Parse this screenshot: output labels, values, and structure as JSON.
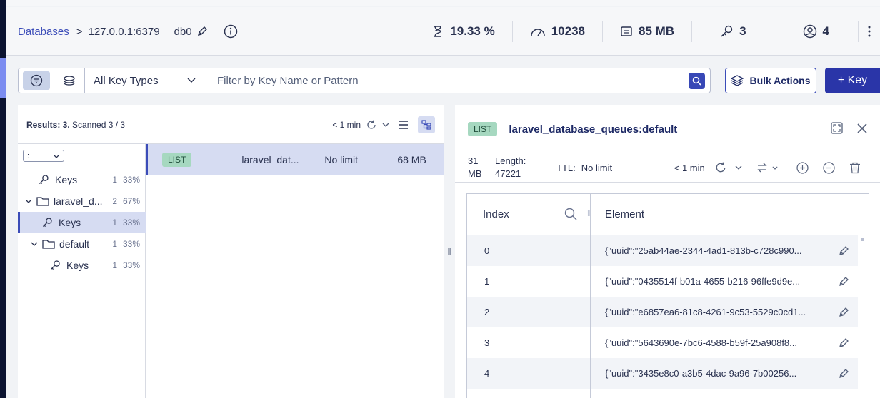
{
  "header": {
    "breadcrumb_databases": "Databases",
    "breadcrumb_sep": ">",
    "host": "127.0.0.1:6379",
    "db": "db0",
    "stats": {
      "cpu": "19.33 %",
      "ops": "10238",
      "memory": "85 MB",
      "keys": "3",
      "clients": "4"
    }
  },
  "toolbar": {
    "key_type": "All Key Types",
    "filter_placeholder": "Filter by Key Name or Pattern",
    "bulk_actions": "Bulk Actions",
    "add_key": "+ Key"
  },
  "left": {
    "results_label": "Results: 3.",
    "scanned": "Scanned 3 / 3",
    "last_refresh": "< 1 min",
    "delimiter": ":",
    "tree": [
      {
        "label": "Keys",
        "count": "1",
        "pct": "33%"
      },
      {
        "label": "laravel_d...",
        "count": "2",
        "pct": "67%"
      },
      {
        "label": "Keys",
        "count": "1",
        "pct": "33%"
      },
      {
        "label": "default",
        "count": "1",
        "pct": "33%"
      },
      {
        "label": "Keys",
        "count": "1",
        "pct": "33%"
      }
    ],
    "key_row": {
      "type": "LIST",
      "name": "laravel_dat...",
      "ttl": "No limit",
      "size": "68 MB"
    }
  },
  "right": {
    "type": "LIST",
    "key_name": "laravel_database_queues:default",
    "size_value": "31",
    "size_unit": "MB",
    "length_label": "Length:",
    "length_value": "47221",
    "ttl_label": "TTL:",
    "ttl_value": "No limit",
    "last_refresh": "< 1 min",
    "col_index": "Index",
    "col_element": "Element",
    "rows": [
      {
        "index": "0",
        "element": "{\"uuid\":\"25ab44ae-2344-4ad1-813b-c728c990..."
      },
      {
        "index": "1",
        "element": "{\"uuid\":\"0435514f-b01a-4655-b216-96ffe9d9e..."
      },
      {
        "index": "2",
        "element": "{\"uuid\":\"e6857ea6-81c8-4261-9c53-5529c0cd1..."
      },
      {
        "index": "3",
        "element": "{\"uuid\":\"5643690e-7bc6-4588-b59f-25a908f8..."
      },
      {
        "index": "4",
        "element": "{\"uuid\":\"3435e8c0-a3b5-4dac-9a96-7b00256..."
      }
    ]
  },
  "icons": [
    "pencil-icon",
    "info-icon",
    "cpu-icon",
    "speedometer-icon",
    "memory-icon",
    "key-icon",
    "user-icon",
    "kebab-icon",
    "filter-icon",
    "stack-icon",
    "chevron-down-icon",
    "search-icon",
    "layers-icon",
    "refresh-icon",
    "list-view-icon",
    "tree-view-icon",
    "folder-icon",
    "expand-icon",
    "close-icon",
    "sort-icon",
    "plus-circle-icon",
    "minus-circle-icon",
    "trash-icon"
  ]
}
